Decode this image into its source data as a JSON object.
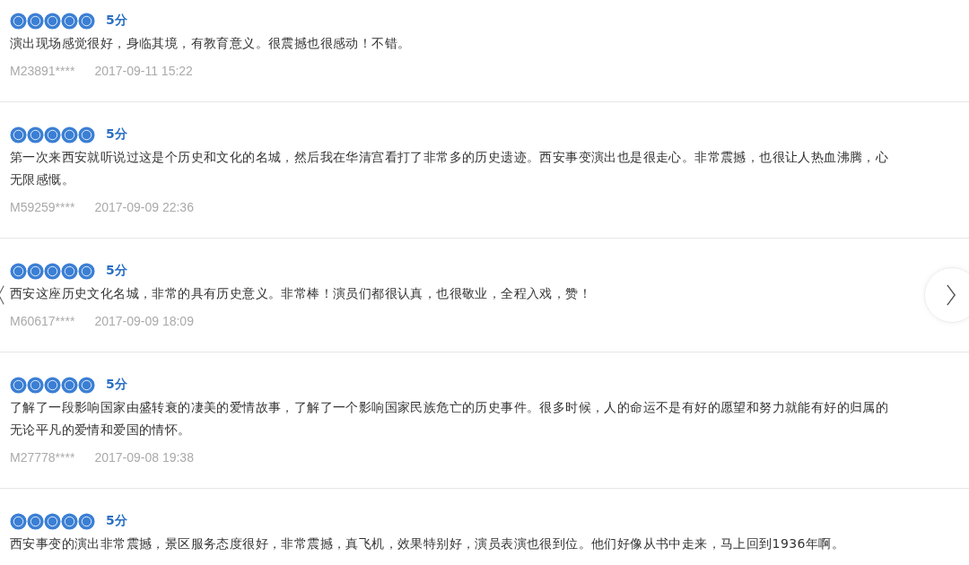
{
  "reviews": [
    {
      "stars": 5,
      "score": "5分",
      "lines": [
        "演出现场感觉很好，身临其境，有教育意义。很震撼也很感动！不错。"
      ],
      "user": "M23891****",
      "time": "2017-09-11 15:22"
    },
    {
      "stars": 5,
      "score": "5分",
      "lines": [
        "第一次来西安就听说过这是个历史和文化的名城，然后我在华清宫看打了非常多的历史遗迹。西安事变演出也是很走心。非常震撼，也很让人热血沸腾，心",
        "无限感慨。"
      ],
      "user": "M59259****",
      "time": "2017-09-09 22:36"
    },
    {
      "stars": 5,
      "score": "5分",
      "lines": [
        "西安这座历史文化名城，非常的具有历史意义。非常棒！演员们都很认真，也很敬业，全程入戏，赞！"
      ],
      "user": "M60617****",
      "time": "2017-09-09 18:09"
    },
    {
      "stars": 5,
      "score": "5分",
      "lines": [
        "了解了一段影响国家由盛转衰的凄美的爱情故事，了解了一个影响国家民族危亡的历史事件。很多时候，人的命运不是有好的愿望和努力就能有好的归属的",
        "无论平凡的爱情和爱国的情怀。"
      ],
      "user": "M27778****",
      "time": "2017-09-08 19:38"
    },
    {
      "stars": 5,
      "score": "5分",
      "lines": [
        "西安事变的演出非常震撼，景区服务态度很好，非常震撼，真飞机，效果特别好，演员表演也很到位。他们好像从书中走来，马上回到1936年啊。"
      ]
    }
  ]
}
